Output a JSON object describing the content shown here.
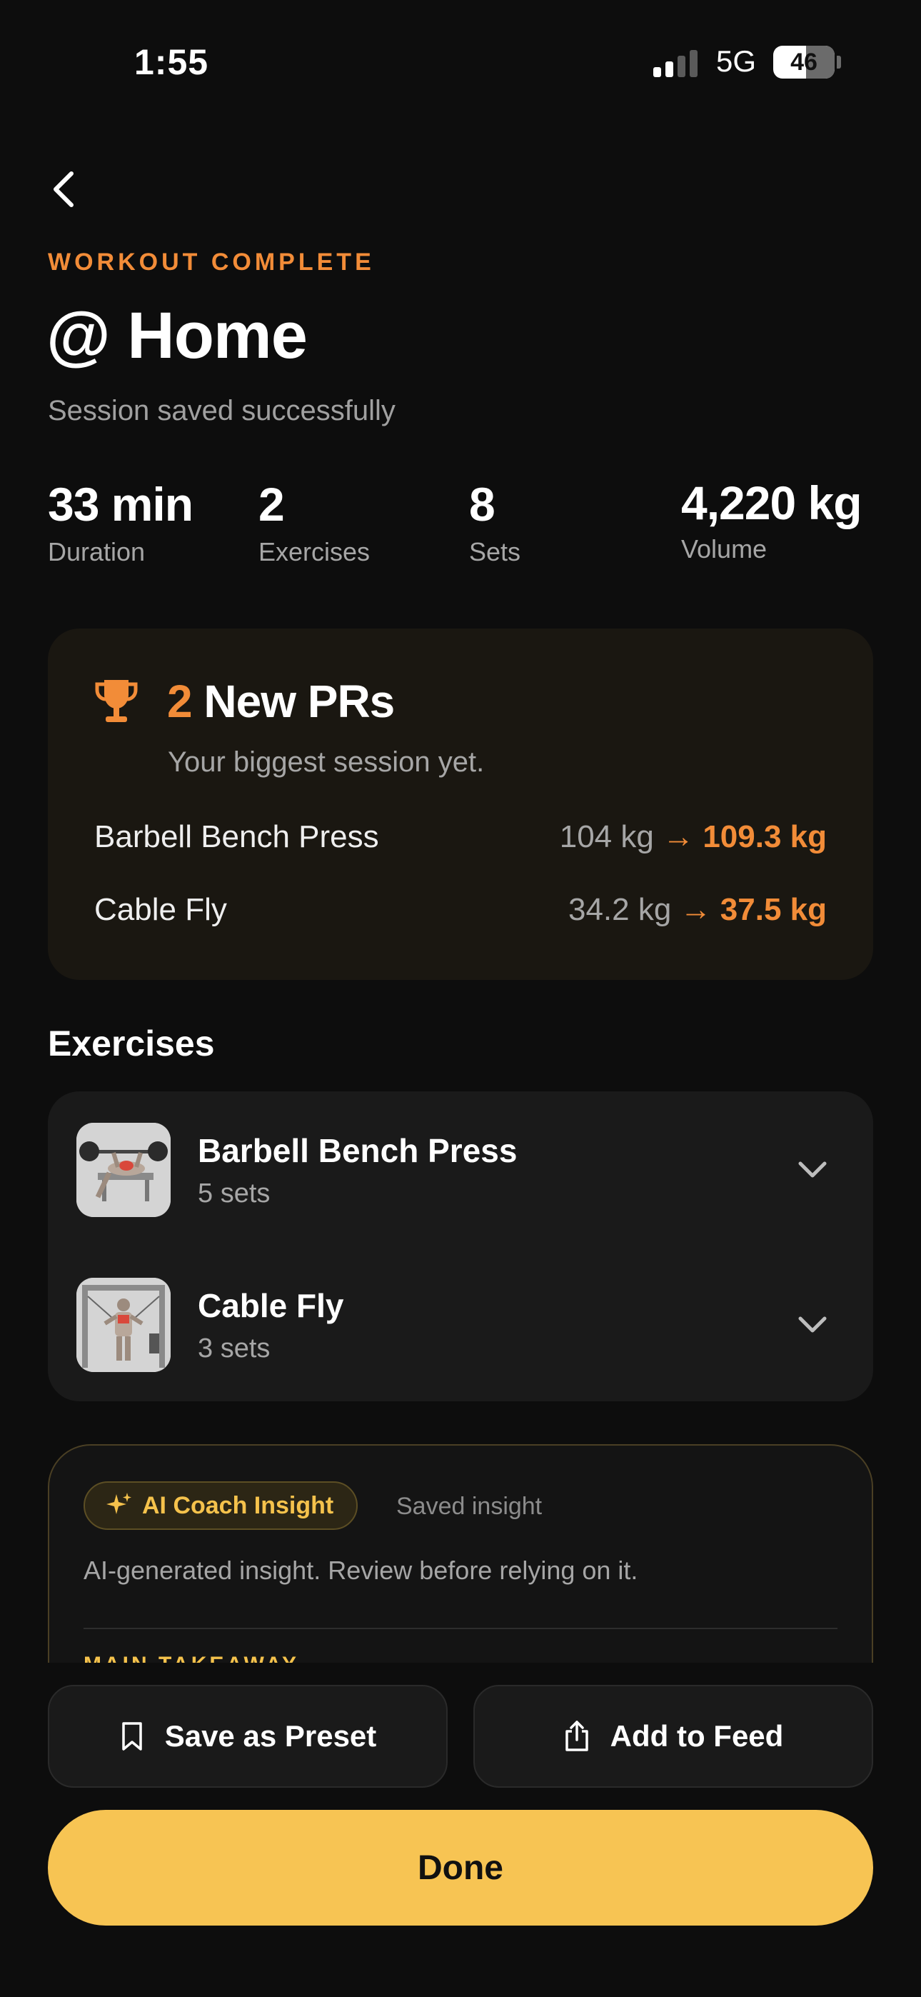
{
  "status_bar": {
    "time": "1:55",
    "network": "5G",
    "battery": "46"
  },
  "header": {
    "eyebrow": "WORKOUT COMPLETE",
    "title": "@ Home",
    "subtitle": "Session saved successfully"
  },
  "stats": [
    {
      "value": "33 min",
      "label": "Duration"
    },
    {
      "value": "2",
      "label": "Exercises"
    },
    {
      "value": "8",
      "label": "Sets"
    },
    {
      "value": "4,220 kg",
      "label": "Volume"
    }
  ],
  "prs": {
    "icon": "trophy-icon",
    "count": "2",
    "title": "New PRs",
    "subtitle": "Your biggest session yet.",
    "arrow": "→",
    "items": [
      {
        "name": "Barbell Bench Press",
        "from": "104 kg",
        "to": "109.3 kg"
      },
      {
        "name": "Cable Fly",
        "from": "34.2 kg",
        "to": "37.5 kg"
      }
    ]
  },
  "exercises": {
    "title": "Exercises",
    "items": [
      {
        "name": "Barbell Bench Press",
        "sets": "5 sets",
        "thumb": "bench-press-thumbnail"
      },
      {
        "name": "Cable Fly",
        "sets": "3 sets",
        "thumb": "cable-fly-thumbnail"
      }
    ]
  },
  "ai_insight": {
    "badge": "AI Coach Insight",
    "status": "Saved insight",
    "disclaimer": "AI-generated insight. Review before relying on it.",
    "section": "MAIN TAKEAWAY"
  },
  "actions": {
    "save_preset": "Save as Preset",
    "add_feed": "Add to Feed",
    "done": "Done"
  },
  "colors": {
    "background": "#0d0d0d",
    "accent_orange": "#f28c38",
    "accent_yellow": "#f7c453",
    "card": "#1a1a1a",
    "pr_card": "#1a1711"
  }
}
